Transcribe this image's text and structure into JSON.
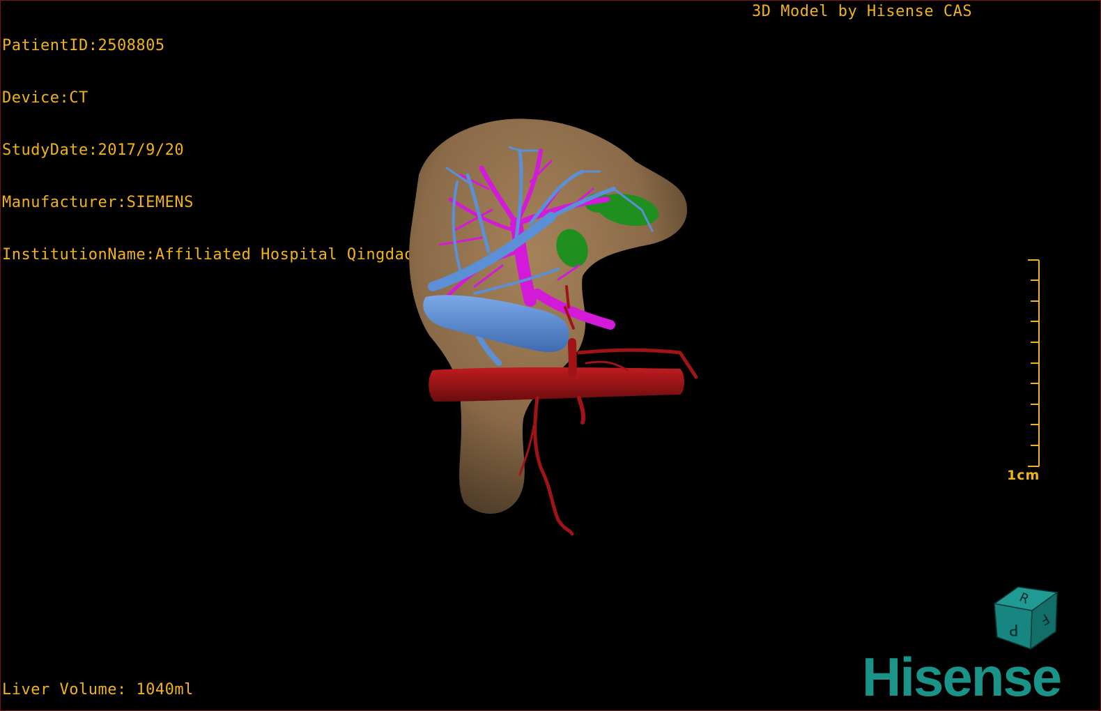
{
  "patient_info": {
    "patient_id": "PatientID:2508805",
    "device": "Device:CT",
    "study_date": "StudyDate:2017/9/20",
    "manufacturer": "Manufacturer:SIEMENS",
    "institution": "InstitutionName:Affiliated Hospital Qingdao University-C"
  },
  "brand_caption": "3D Model by Hisense CAS",
  "liver_volume": "Liver Volume: 1040ml",
  "scale": {
    "label": "1cm"
  },
  "orientation_cube": {
    "face_top": "R",
    "face_left": "P",
    "face_right": "F"
  },
  "logo": "Hisense",
  "colors": {
    "overlay_text": "#f2b21a",
    "liver": "#8a6a48",
    "portal_vein": "#5b8fd6",
    "hepatic_vein": "#d21ad8",
    "artery": "#a01418",
    "gallbladder": "#1f8f1f",
    "logo": "#1a9488"
  }
}
